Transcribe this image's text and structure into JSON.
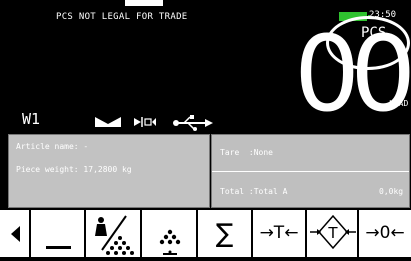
{
  "header": {
    "legal_text": "PCS NOT LEGAL FOR TRADE",
    "clock": "23:50"
  },
  "display": {
    "weight": "0",
    "unit": "PCS",
    "load_label": "LOAD"
  },
  "status": {
    "scale_label": "W1"
  },
  "info": {
    "article_name": "Article name: -",
    "piece_weight": "Piece weight: 17,2800 kg",
    "tare": "Tare  :None",
    "total": "Total :Total A",
    "total_value": "0,0kg"
  },
  "toolbar": {
    "sum_symbol": "∑",
    "tare_symbol": "→T←",
    "zero_symbol": "→0←"
  },
  "colors": {
    "background": "#000000",
    "panel": "#c2c2c2",
    "battery": "#2fc22f",
    "button": "#ffffff"
  }
}
